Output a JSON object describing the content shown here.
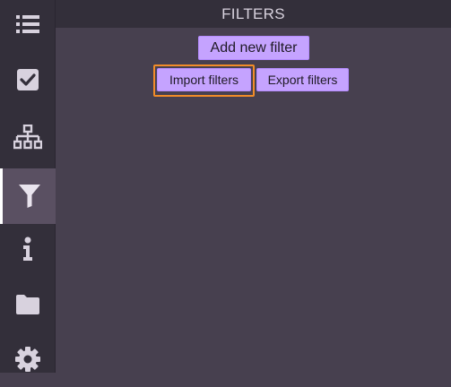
{
  "header": {
    "title": "FILTERS"
  },
  "sidebar": {
    "items": [
      {
        "icon": "list-icon",
        "active": false
      },
      {
        "icon": "checkbox-icon",
        "active": false
      },
      {
        "icon": "network-icon",
        "active": false
      },
      {
        "icon": "filter-icon",
        "active": true
      },
      {
        "icon": "info-icon",
        "active": false
      },
      {
        "icon": "folder-icon",
        "active": false
      },
      {
        "icon": "gear-icon",
        "active": false
      }
    ]
  },
  "main": {
    "add_label": "Add new filter",
    "import_label": "Import filters",
    "export_label": "Export filters"
  },
  "colors": {
    "background": "#47404f",
    "sidebar": "#332f3a",
    "sidebar_active": "#5a5062",
    "button": "#c5a3ff",
    "focus_outline": "#f28c28",
    "icon": "#d8d2de"
  }
}
